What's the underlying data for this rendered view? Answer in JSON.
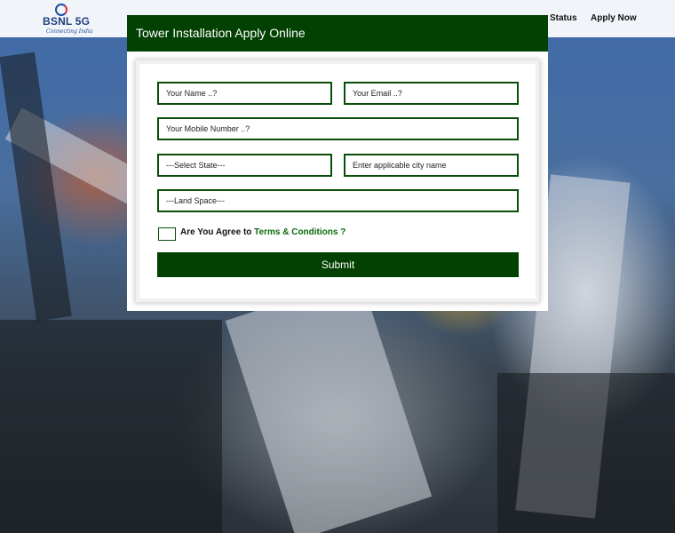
{
  "navbar": {
    "brand": "BSNL 5G",
    "tagline": "Connecting India",
    "links": {
      "status": "Status",
      "apply_now": "Apply Now"
    }
  },
  "modal": {
    "title": "Tower Installation Apply Online",
    "fields": {
      "name_placeholder": "Your Name ..?",
      "email_placeholder": "Your Email ..?",
      "mobile_placeholder": "Your Mobile Number ..?",
      "state_selected": "---Select State---",
      "city_placeholder": "Enter applicable city name",
      "land_space_selected": "---Land Space---"
    },
    "agree": {
      "prefix": "Are You Agree to",
      "link": "Terms & Conditions ?"
    },
    "submit_label": "Submit"
  },
  "colors": {
    "header_green": "#024102",
    "field_border": "#0a4d0a",
    "link_green": "#0a6b0a"
  }
}
